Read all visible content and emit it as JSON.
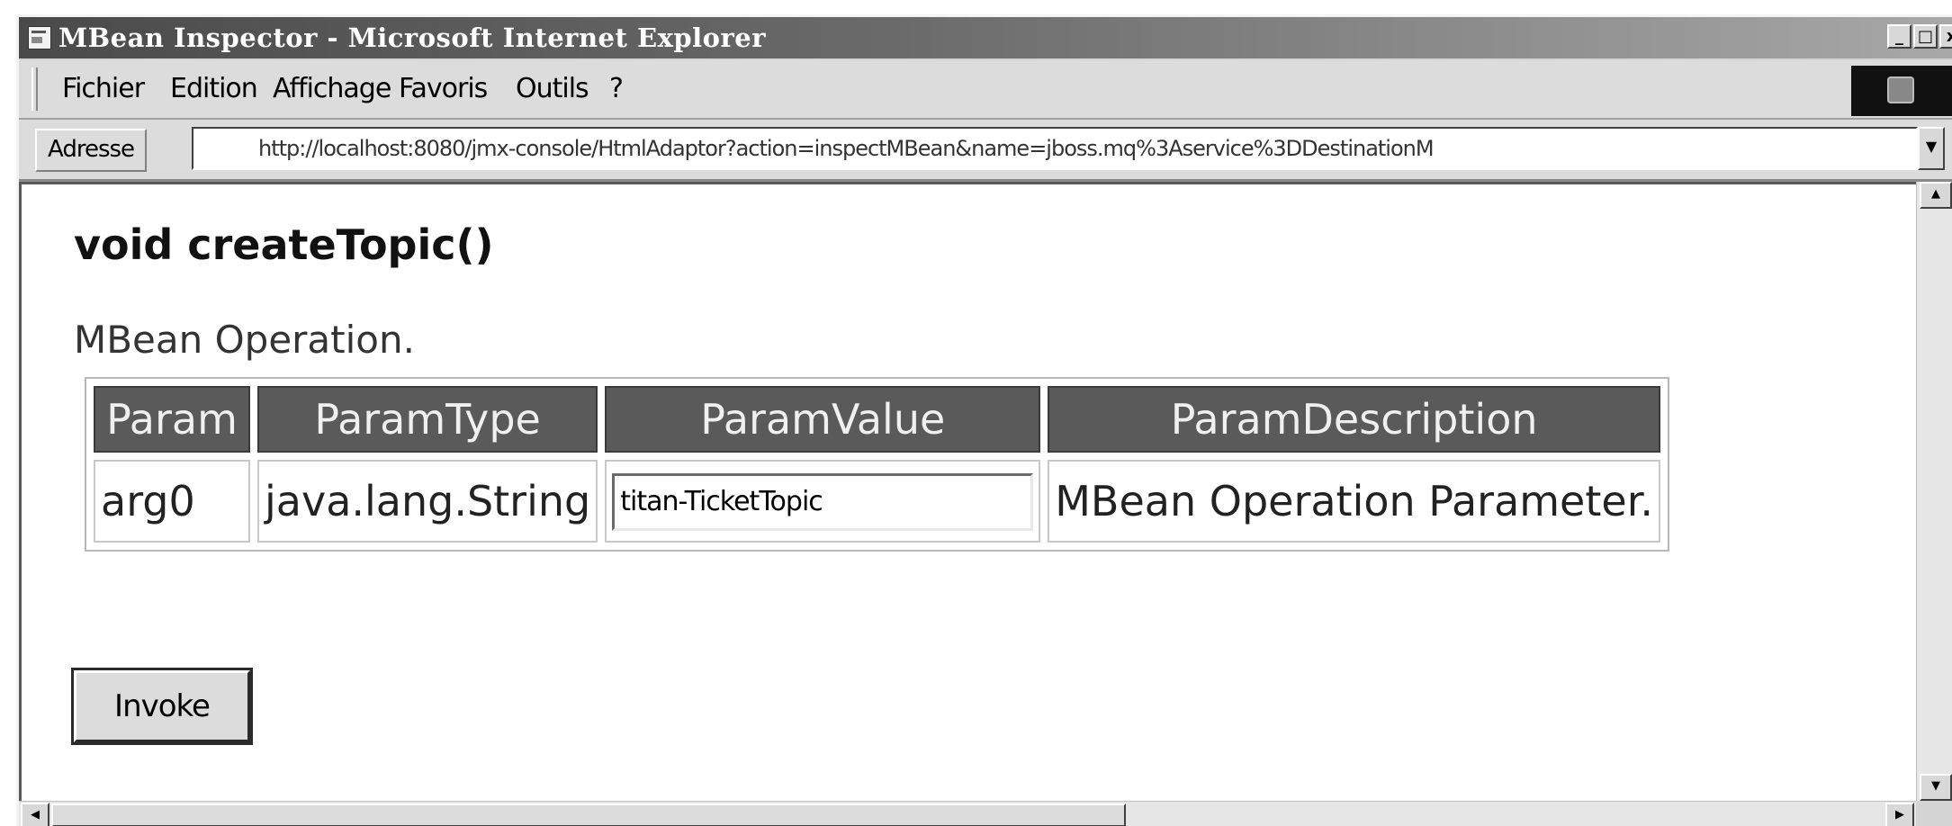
{
  "window": {
    "title": "MBean Inspector - Microsoft Internet Explorer",
    "controls": {
      "minimize": "_",
      "maximize": "□",
      "close": "x"
    }
  },
  "menubar": {
    "items": [
      "Fichier",
      "Edition",
      "Affichage",
      "Favoris",
      "Outils",
      "?"
    ]
  },
  "addressbar": {
    "label": "Adresse",
    "url": "http://localhost:8080/jmx-console/HtmlAdaptor?action=inspectMBean&name=jboss.mq%3Aservice%3DDestinationM"
  },
  "content": {
    "operation_title": "void createTopic()",
    "operation_description": "MBean Operation.",
    "table": {
      "headers": [
        "Param",
        "ParamType",
        "ParamValue",
        "ParamDescription"
      ],
      "row": {
        "param": "arg0",
        "type": "java.lang.String",
        "value": "titan-TicketTopic",
        "description": "MBean Operation Parameter."
      }
    },
    "invoke_label": "Invoke"
  }
}
